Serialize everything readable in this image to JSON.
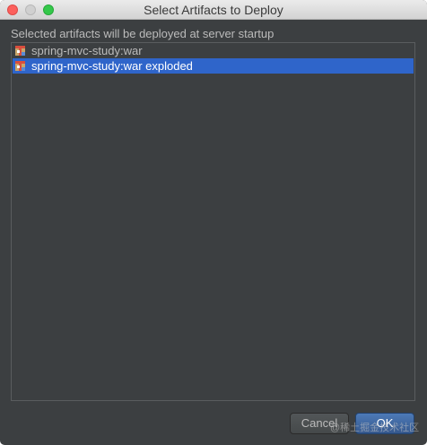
{
  "window": {
    "title": "Select Artifacts to Deploy"
  },
  "description": "Selected artifacts will be deployed at server startup",
  "artifacts": [
    {
      "label": "spring-mvc-study:war",
      "icon": "war-artifact-icon",
      "selected": false
    },
    {
      "label": "spring-mvc-study:war exploded",
      "icon": "war-artifact-icon",
      "selected": true
    }
  ],
  "buttons": {
    "cancel_label": "Cancel",
    "ok_label": "OK"
  },
  "watermark": "@稀土掘金技术社区",
  "colors": {
    "background": "#3c3f41",
    "selection": "#2f65ca",
    "text": "#bbbbbb",
    "ok_button": "#3e68a3"
  }
}
